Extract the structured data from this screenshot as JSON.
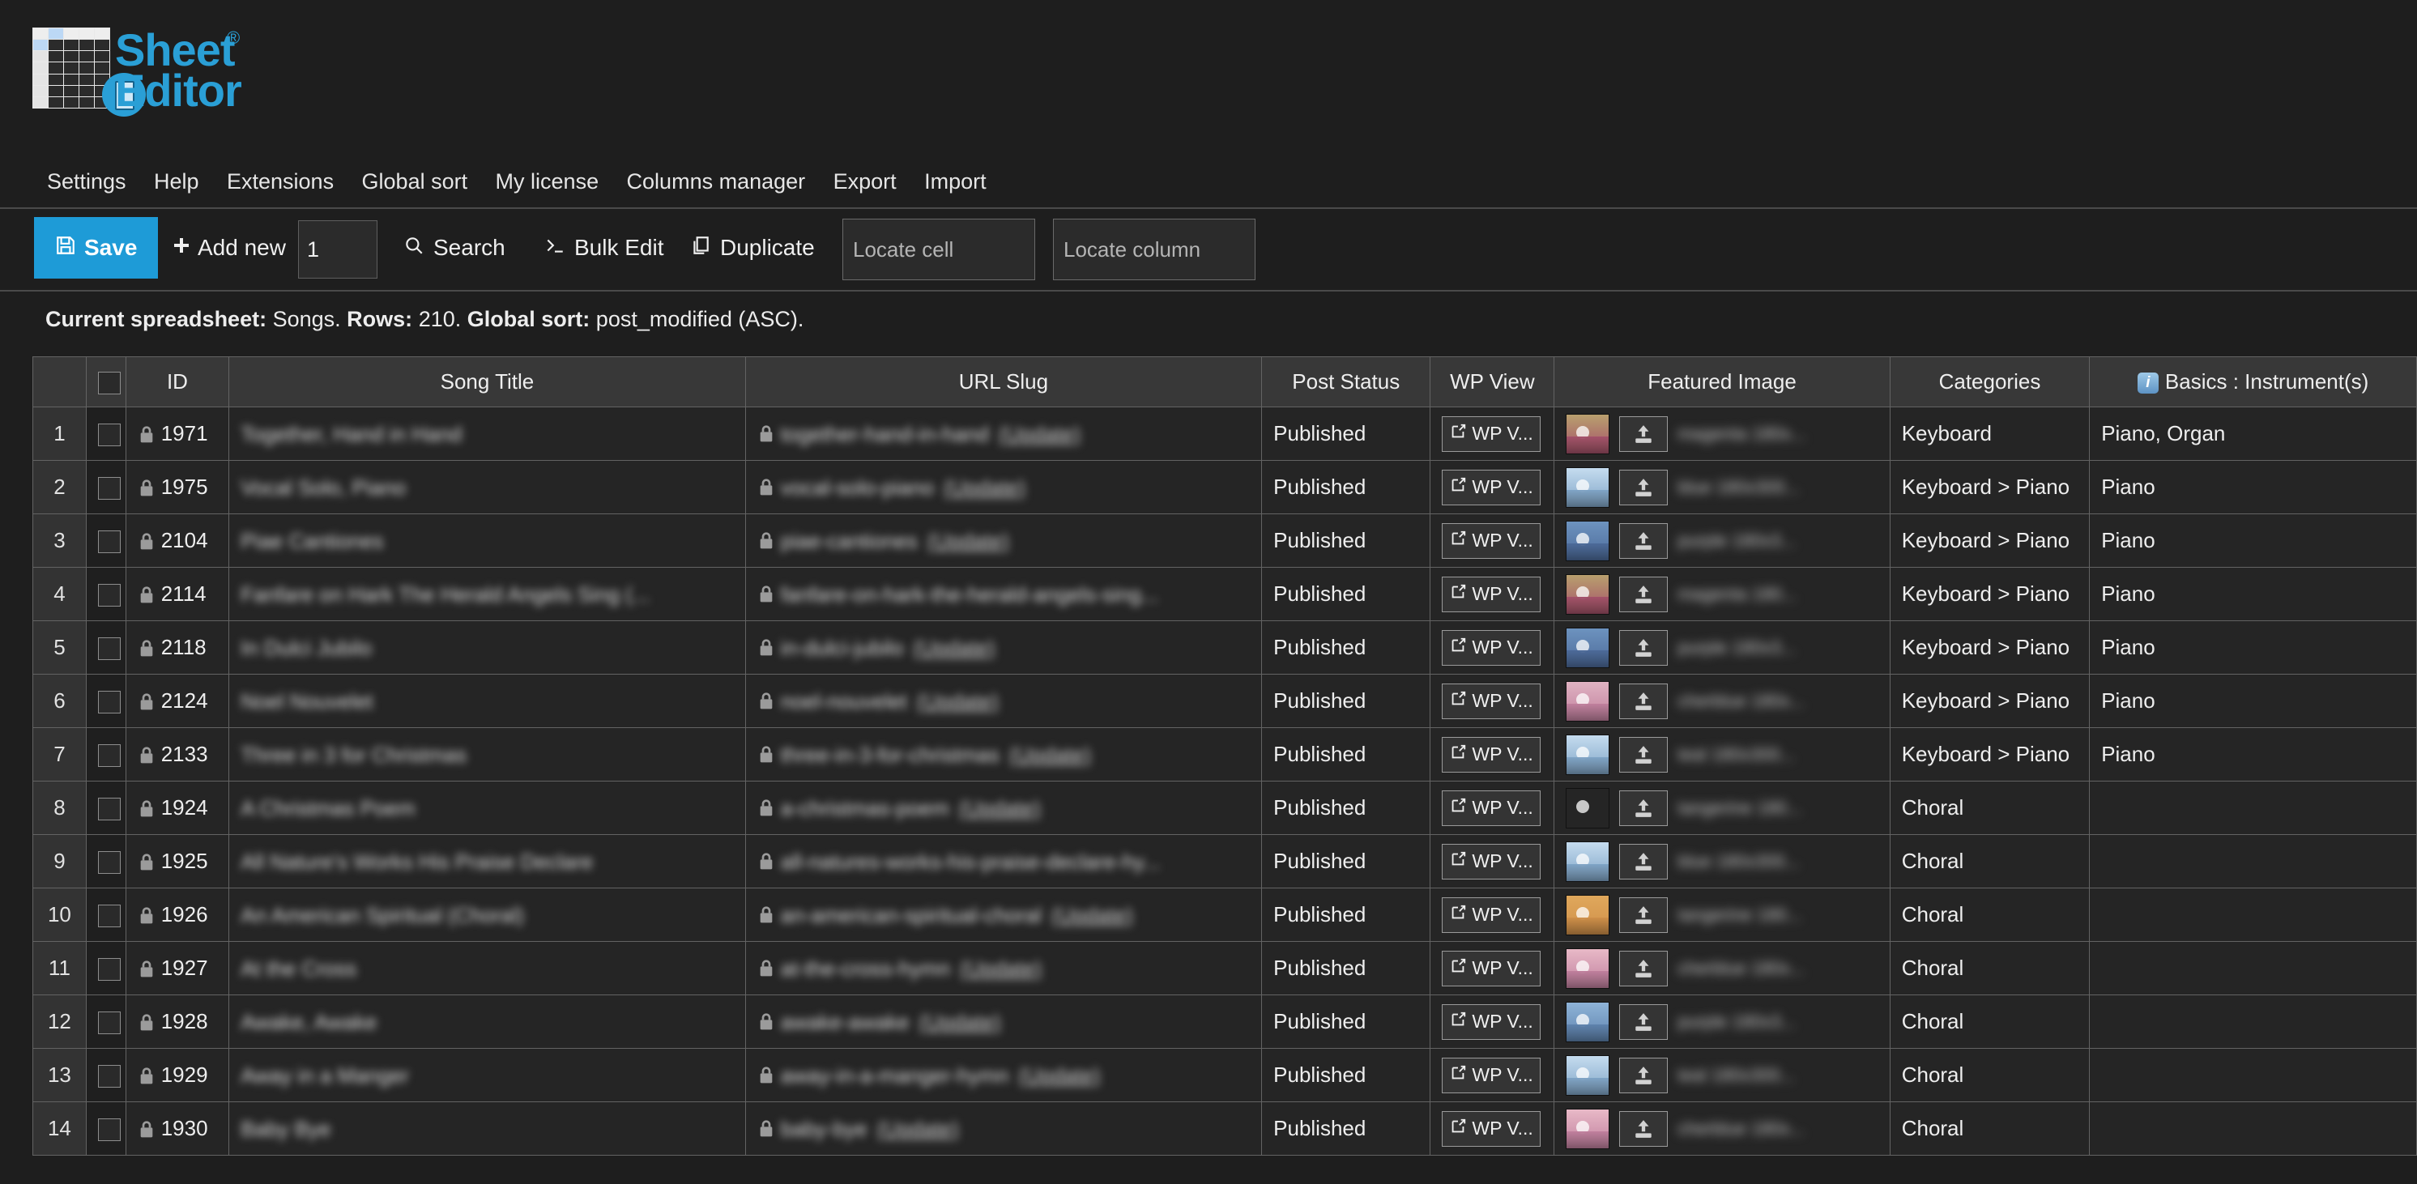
{
  "brand": {
    "name_line1": "Sheet",
    "name_line2": "Editor",
    "registered_mark": "®",
    "accent_color": "#2a9fd6"
  },
  "menubar": {
    "items": [
      {
        "label": "Settings"
      },
      {
        "label": "Help"
      },
      {
        "label": "Extensions"
      },
      {
        "label": "Global sort"
      },
      {
        "label": "My license"
      },
      {
        "label": "Columns manager"
      },
      {
        "label": "Export"
      },
      {
        "label": "Import"
      }
    ]
  },
  "toolbar": {
    "save_label": "Save",
    "save_icon": "floppy-disk-icon",
    "add_new_label": "Add new",
    "add_new_icon": "plus-icon",
    "rows_to_add_value": "1",
    "search_label": "Search",
    "search_icon": "magnifier-icon",
    "bulk_edit_label": "Bulk Edit",
    "bulk_edit_icon": "terminal-prompt-icon",
    "duplicate_label": "Duplicate",
    "duplicate_icon": "copy-icon",
    "locate_cell_placeholder": "Locate cell",
    "locate_cell_value": "",
    "locate_column_placeholder": "Locate column",
    "locate_column_value": ""
  },
  "status": {
    "spreadsheet_label": "Current spreadsheet:",
    "spreadsheet_name": "Songs.",
    "rows_label": "Rows:",
    "rows_value": "210.",
    "sort_label": "Global sort:",
    "sort_value": "post_modified (ASC)."
  },
  "table": {
    "headers": {
      "rownum": "",
      "select_all": "",
      "id": "ID",
      "title": "Song Title",
      "slug": "URL Slug",
      "status": "Post Status",
      "wpview": "WP View",
      "image": "Featured Image",
      "categories": "Categories",
      "instruments": "Basics : Instrument(s)"
    },
    "wp_view_label": "WP V...",
    "instruments_info_icon": "info-icon",
    "rows": [
      {
        "n": "1",
        "id": "1971",
        "title": "Together, Hand in Hand",
        "slug": "together-hand-in-hand",
        "slug_link": "(Update)",
        "status": "Published",
        "image_name": "magenta 180x...",
        "thumb_top": "#b9a06e",
        "thumb_bottom": "#a4506a",
        "categories": "Keyboard",
        "instruments": "Piano, Organ"
      },
      {
        "n": "2",
        "id": "1975",
        "title": "Vocal Solo, Piano",
        "slug": "vocal-solo-piano",
        "slug_link": "(Update)",
        "status": "Published",
        "image_name": "blue 180x300...",
        "thumb_top": "#c5dcef",
        "thumb_bottom": "#7fa4c6",
        "categories": "Keyboard > Piano",
        "instruments": "Piano"
      },
      {
        "n": "3",
        "id": "2104",
        "title": "Piae Cantiones",
        "slug": "piae-cantiones",
        "slug_link": "(Update)",
        "status": "Published",
        "image_name": "purple 180x3...",
        "thumb_top": "#6d93bf",
        "thumb_bottom": "#4c6a99",
        "categories": "Keyboard > Piano",
        "instruments": "Piano"
      },
      {
        "n": "4",
        "id": "2114",
        "title": "Fanfare on Hark The Herald Angels Sing (...",
        "slug": "fanfare-on-hark-the-herald-angels-sing...",
        "slug_link": "",
        "status": "Published",
        "image_name": "magenta 180...",
        "thumb_top": "#b9a06e",
        "thumb_bottom": "#a4506a",
        "categories": "Keyboard > Piano",
        "instruments": "Piano"
      },
      {
        "n": "5",
        "id": "2118",
        "title": "In Dulci Jubilo",
        "slug": "in-dulci-jubilo",
        "slug_link": "(Update)",
        "status": "Published",
        "image_name": "purple 180x3...",
        "thumb_top": "#6d93bf",
        "thumb_bottom": "#4c6a99",
        "categories": "Keyboard > Piano",
        "instruments": "Piano"
      },
      {
        "n": "6",
        "id": "2124",
        "title": "Noel Nouvelet",
        "slug": "noel-nouvelet",
        "slug_link": "(Update)",
        "status": "Published",
        "image_name": "cherblue 180x...",
        "thumb_top": "#e0b3c2",
        "thumb_bottom": "#c07f9d",
        "categories": "Keyboard > Piano",
        "instruments": "Piano"
      },
      {
        "n": "7",
        "id": "2133",
        "title": "Three in 3 for Christmas",
        "slug": "three-in-3-for-christmas",
        "slug_link": "(Update)",
        "status": "Published",
        "image_name": "teal 180x300...",
        "thumb_top": "#c5dcef",
        "thumb_bottom": "#7fa4c6",
        "categories": "Keyboard > Piano",
        "instruments": "Piano"
      },
      {
        "n": "8",
        "id": "1924",
        "title": "A Christmas Poem",
        "slug": "a-christmas-poem",
        "slug_link": "(Update)",
        "status": "Published",
        "image_name": "tangerine 180...",
        "thumb_top": "#e0a85c",
        "thumb_bottom": "#d79murky",
        "categories": "Choral",
        "instruments": ""
      },
      {
        "n": "9",
        "id": "1925",
        "title": "All Nature's Works His Praise Declare",
        "slug": "all-natures-works-his-praise-declare-hy...",
        "slug_link": "",
        "status": "Published",
        "image_name": "blue 180x300...",
        "thumb_top": "#c5dcef",
        "thumb_bottom": "#7fa4c6",
        "categories": "Choral",
        "instruments": ""
      },
      {
        "n": "10",
        "id": "1926",
        "title": "An American Spiritual (Choral)",
        "slug": "an-american-spiritual-choral",
        "slug_link": "(Update)",
        "status": "Published",
        "image_name": "tangerine 180...",
        "thumb_top": "#e0a85c",
        "thumb_bottom": "#cf8f49",
        "categories": "Choral",
        "instruments": ""
      },
      {
        "n": "11",
        "id": "1927",
        "title": "At the Cross",
        "slug": "at-the-cross-hymn",
        "slug_link": "(Update)",
        "status": "Published",
        "image_name": "cherblue 180x...",
        "thumb_top": "#e8b9c7",
        "thumb_bottom": "#c07f9d",
        "categories": "Choral",
        "instruments": ""
      },
      {
        "n": "12",
        "id": "1928",
        "title": "Awake, Awake",
        "slug": "awake-awake",
        "slug_link": "(Update)",
        "status": "Published",
        "image_name": "purple 180x3...",
        "thumb_top": "#8fb4d8",
        "thumb_bottom": "#5e82ad",
        "categories": "Choral",
        "instruments": ""
      },
      {
        "n": "13",
        "id": "1929",
        "title": "Away in a Manger",
        "slug": "away-in-a-manger-hymn",
        "slug_link": "(Update)",
        "status": "Published",
        "image_name": "teal 180x300...",
        "thumb_top": "#c5dcef",
        "thumb_bottom": "#7fa4c6",
        "categories": "Choral",
        "instruments": ""
      },
      {
        "n": "14",
        "id": "1930",
        "title": "Baby Bye",
        "slug": "baby-bye",
        "slug_link": "(Update)",
        "status": "Published",
        "image_name": "cherblue 180x...",
        "thumb_top": "#e8b9c7",
        "thumb_bottom": "#c07f9d",
        "categories": "Choral",
        "instruments": ""
      }
    ]
  }
}
